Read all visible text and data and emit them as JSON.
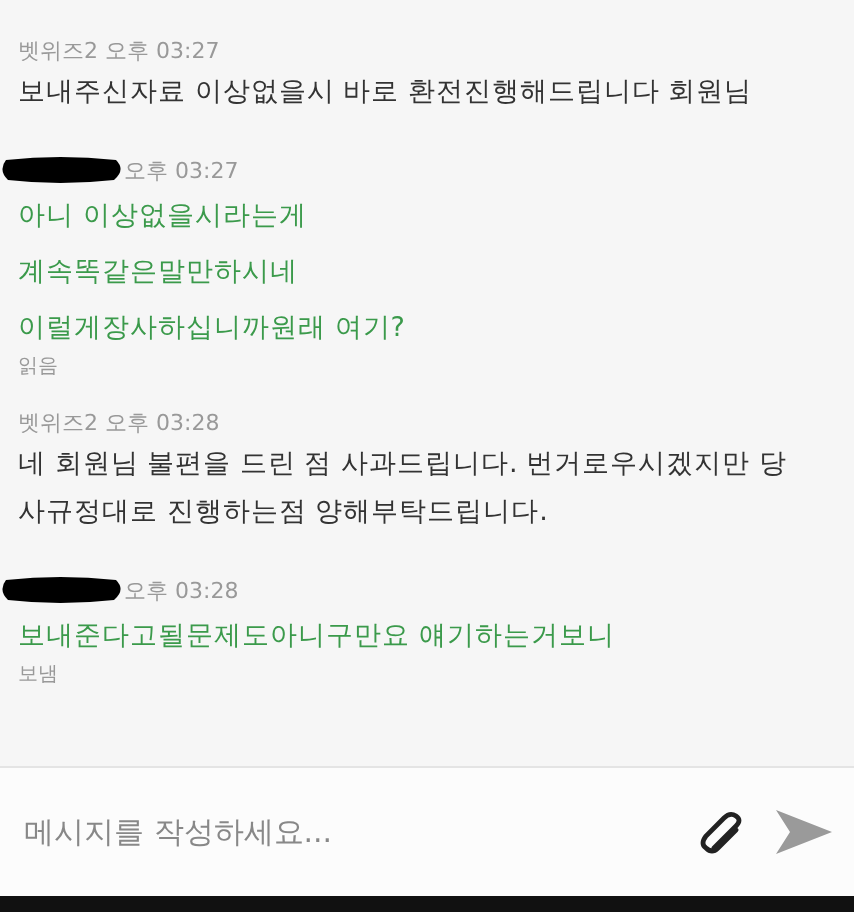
{
  "messages": [
    {
      "kind": "agent",
      "sender": "벳위즈2",
      "time": "오후 03:27",
      "lines": [
        "보내주신자료 이상없을시 바로 환전진행해드립니다 회원님"
      ]
    },
    {
      "kind": "user",
      "redacted": true,
      "time": "오후 03:27",
      "lines": [
        "아니 이상없을시라는게",
        "계속똑같은말만하시네",
        "이럴게장사하십니까원래 여기?"
      ],
      "status": "읽음"
    },
    {
      "kind": "agent",
      "sender": "벳위즈2",
      "time": "오후 03:28",
      "lines": [
        "네 회원님 불편을 드린 점 사과드립니다. 번거로우시겠지만 당사규정대로 진행하는점 양해부탁드립니다."
      ]
    },
    {
      "kind": "user",
      "redacted": true,
      "time": "오후 03:28",
      "lines": [
        "보내준다고될문제도아니구만요 얘기하는거보니"
      ],
      "status": "보냄"
    }
  ],
  "composer": {
    "placeholder": "메시지를 작성하세요..."
  }
}
